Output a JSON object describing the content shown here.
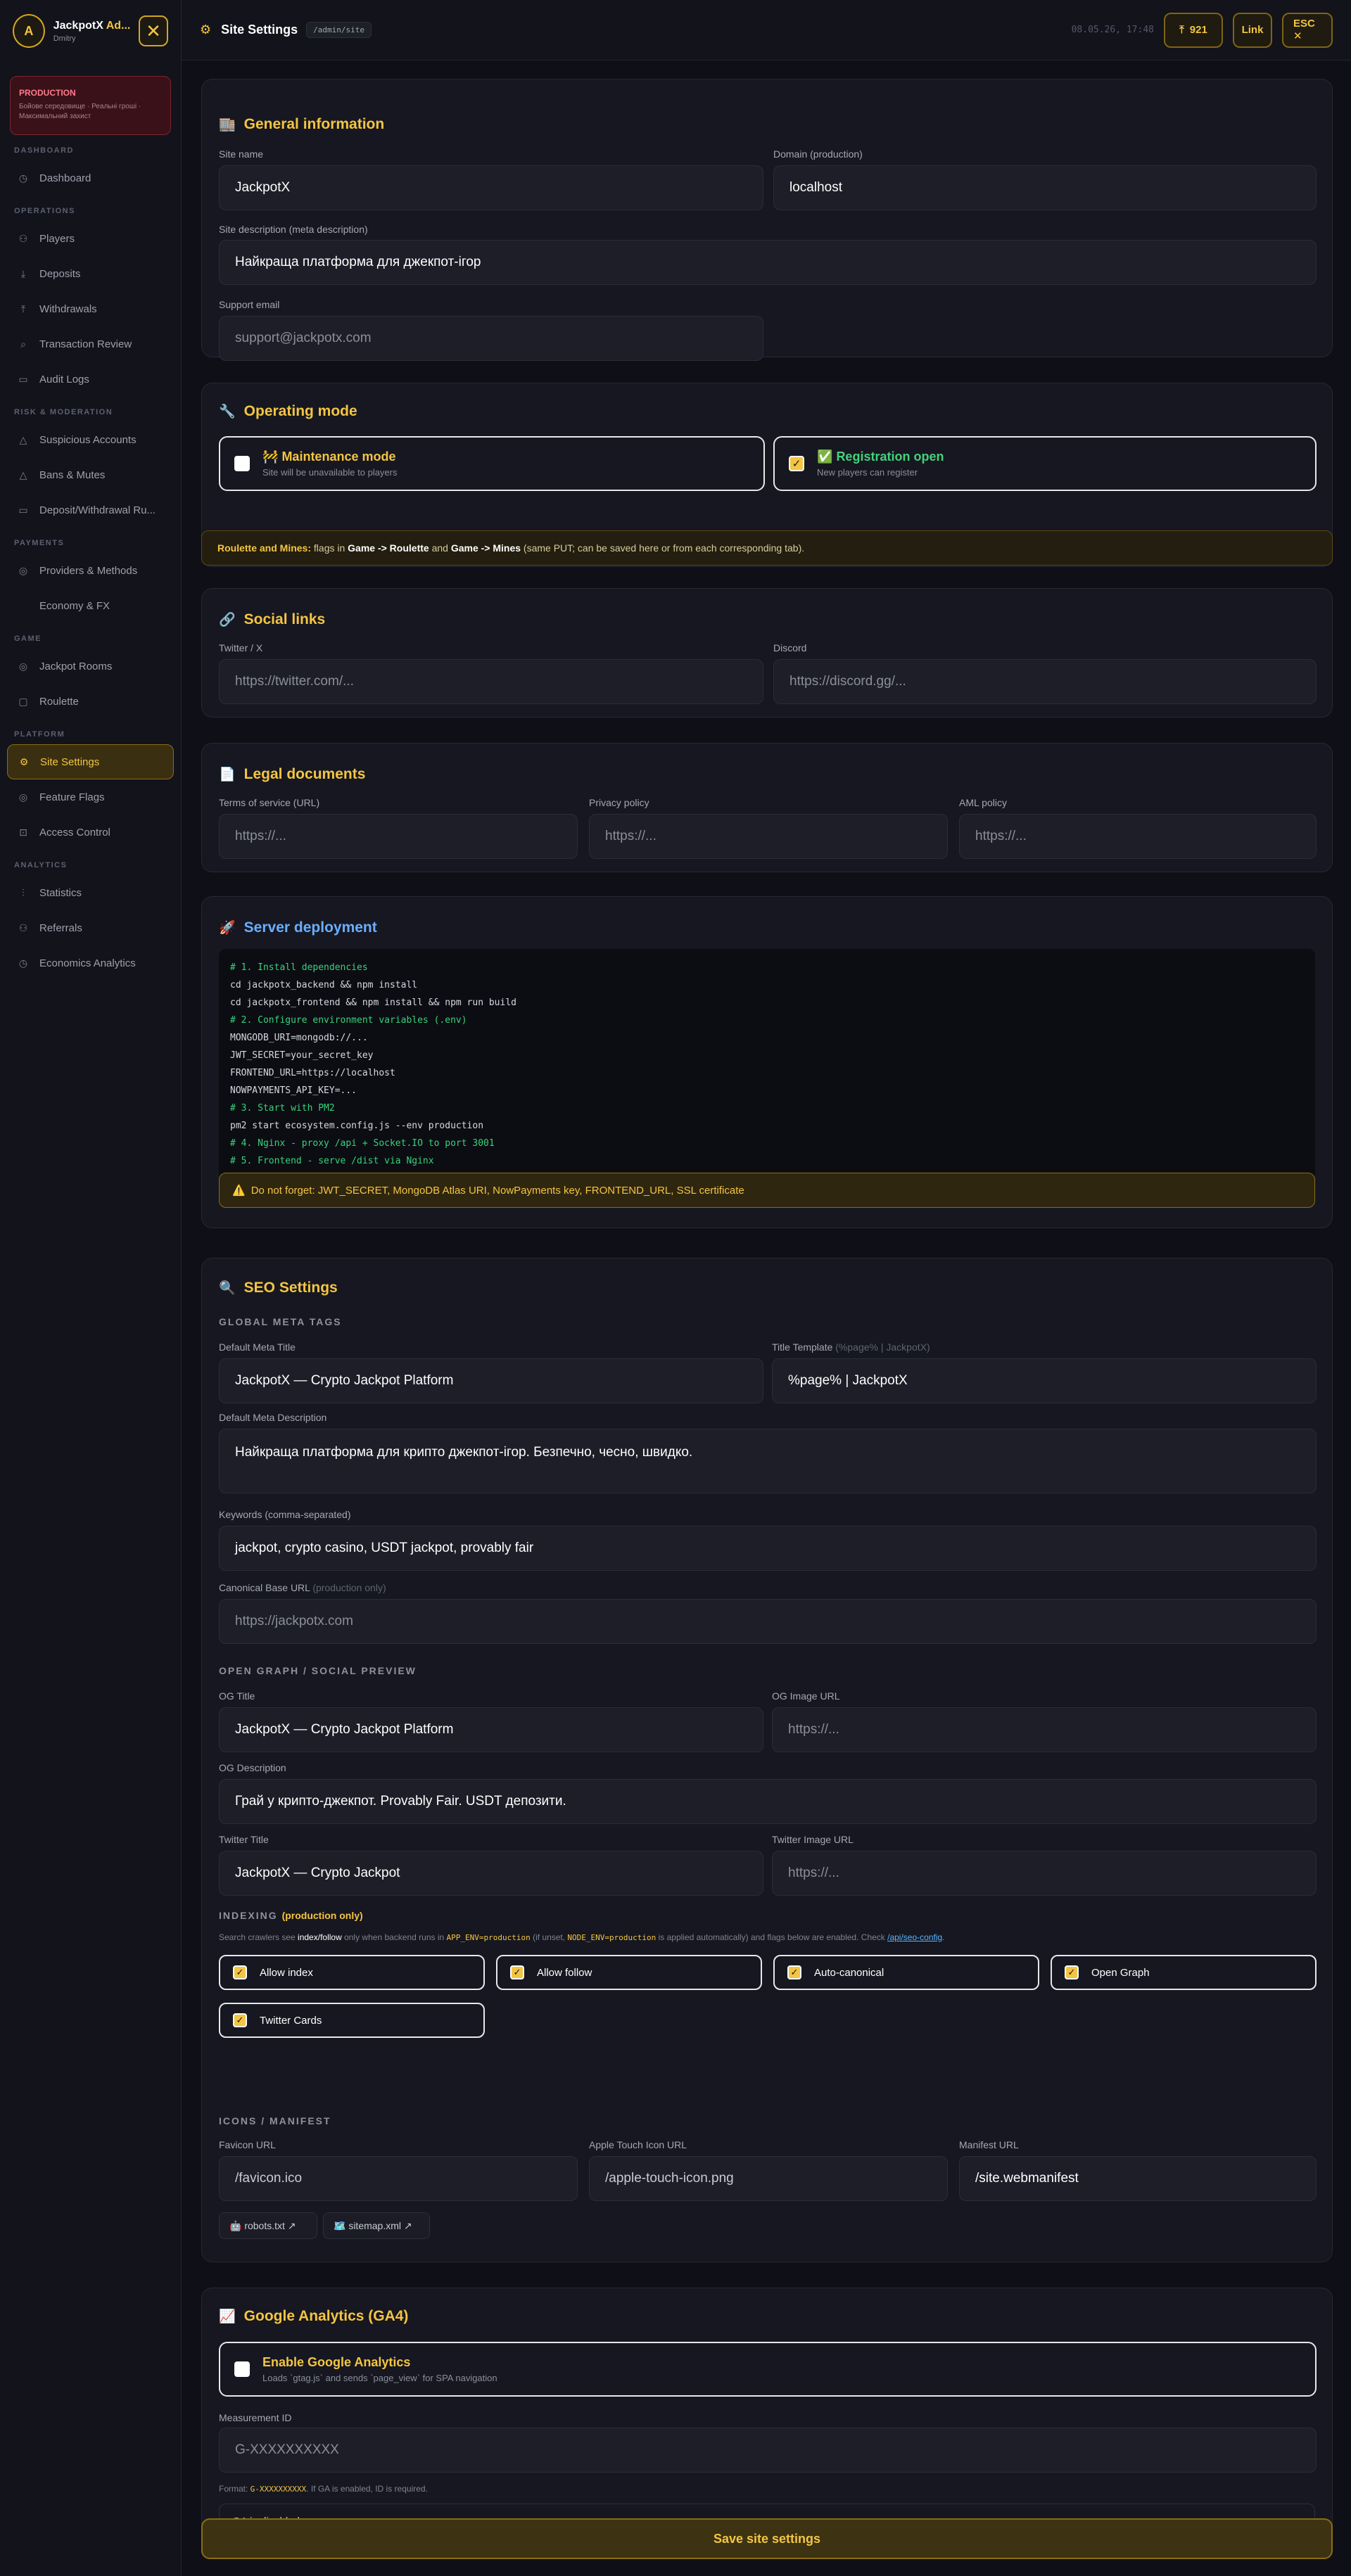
{
  "sidebar": {
    "avatar_letter": "A",
    "brand": "JackpotX",
    "brand_suffix": " Ad...",
    "user": "Dmitry",
    "close_glyph": "✕",
    "env": {
      "title": "PRODUCTION",
      "subtitle": "Бойове середовище · Реальні гроші · Максимальний захист"
    },
    "sections": [
      {
        "title": "DASHBOARD",
        "items": [
          {
            "label": "Dashboard",
            "icon": "◷"
          }
        ]
      },
      {
        "title": "OPERATIONS",
        "items": [
          {
            "label": "Players",
            "icon": "⚇"
          },
          {
            "label": "Deposits",
            "icon": "⤓"
          },
          {
            "label": "Withdrawals",
            "icon": "⤒"
          },
          {
            "label": "Transaction Review",
            "icon": "⌕"
          },
          {
            "label": "Audit Logs",
            "icon": "▭"
          }
        ]
      },
      {
        "title": "RISK & MODERATION",
        "items": [
          {
            "label": "Suspicious Accounts",
            "icon": "△"
          },
          {
            "label": "Bans & Mutes",
            "icon": "△"
          },
          {
            "label": "Deposit/Withdrawal Ru...",
            "icon": "▭"
          }
        ]
      },
      {
        "title": "PAYMENTS",
        "items": [
          {
            "label": "Providers & Methods",
            "icon": "◎"
          },
          {
            "label": "Economy & FX",
            "icon": ""
          }
        ]
      },
      {
        "title": "GAME",
        "items": [
          {
            "label": "Jackpot Rooms",
            "icon": "◎"
          },
          {
            "label": "Roulette",
            "icon": "▢"
          }
        ]
      },
      {
        "title": "PLATFORM",
        "items": [
          {
            "label": "Site Settings",
            "icon": "⚙",
            "active": true
          },
          {
            "label": "Feature Flags",
            "icon": "◎"
          },
          {
            "label": "Access Control",
            "icon": "⊡"
          }
        ]
      },
      {
        "title": "ANALYTICS",
        "items": [
          {
            "label": "Statistics",
            "icon": "⫶"
          },
          {
            "label": "Referrals",
            "icon": "⚇"
          },
          {
            "label": "Economics Analytics",
            "icon": "◷"
          }
        ]
      }
    ]
  },
  "topbar": {
    "icon": "⚙",
    "title": "Site Settings",
    "path": "/admin/site",
    "clock": "08.05.26, 17:48",
    "count_icon": "⤒",
    "count": "921",
    "link_label": "Link",
    "esc_label": "ESC ✕"
  },
  "general": {
    "icon": "🏬",
    "title": "General information",
    "site_name_label": "Site name",
    "site_name": "JackpotX",
    "domain_label": "Domain (production)",
    "domain": "localhost",
    "desc_label": "Site description (meta description)",
    "desc": "Найкраща платформа для джекпот-ігор",
    "email_label": "Support email",
    "email_placeholder": "support@jackpotx.com"
  },
  "mode": {
    "icon": "🔧",
    "title": "Operating mode",
    "maintenance_icon": "🚧",
    "maintenance_title": "Maintenance mode",
    "maintenance_sub": "Site will be unavailable to players",
    "registration_icon": "✅",
    "registration_title": "Registration open",
    "registration_sub": "New players can register",
    "checkmark": "✓"
  },
  "notice": {
    "lead": "Roulette and Mines:",
    "p1": " flags in ",
    "g1": "Game -> Roulette",
    "p2": " and ",
    "g2": "Game -> Mines",
    "p3": " (same PUT; can be saved here or from each corresponding tab)."
  },
  "social": {
    "icon": "🔗",
    "title": "Social links",
    "twitter_label": "Twitter / X",
    "twitter_ph": "https://twitter.com/...",
    "discord_label": "Discord",
    "discord_ph": "https://discord.gg/..."
  },
  "legal": {
    "icon": "📄",
    "title": "Legal documents",
    "tos_label": "Terms of service (URL)",
    "privacy_label": "Privacy policy",
    "aml_label": "AML policy",
    "ph": "https://..."
  },
  "deploy": {
    "icon": "🚀",
    "title": "Server deployment",
    "lines": [
      {
        "t": "# 1. Install dependencies",
        "c": true
      },
      {
        "t": "cd jackpotx_backend && npm install",
        "c": false
      },
      {
        "t": "cd jackpotx_frontend && npm install && npm run build",
        "c": false
      },
      {
        "t": "# 2. Configure environment variables (.env)",
        "c": true
      },
      {
        "t": "MONGODB_URI=mongodb://...",
        "c": false
      },
      {
        "t": "JWT_SECRET=your_secret_key",
        "c": false
      },
      {
        "t": "FRONTEND_URL=https://localhost",
        "c": false
      },
      {
        "t": "NOWPAYMENTS_API_KEY=...",
        "c": false
      },
      {
        "t": "# 3. Start with PM2",
        "c": true
      },
      {
        "t": "pm2 start ecosystem.config.js --env production",
        "c": false
      },
      {
        "t": "# 4. Nginx - proxy /api + Socket.IO to port 3001",
        "c": true
      },
      {
        "t": "# 5. Frontend - serve /dist via Nginx",
        "c": true
      }
    ],
    "warning_icon": "⚠️",
    "warning": "Do not forget: JWT_SECRET, MongoDB Atlas URI, NowPayments key, FRONTEND_URL, SSL certificate"
  },
  "seo": {
    "icon": "🔍",
    "title": "SEO Settings",
    "global_title": "GLOBAL META TAGS",
    "meta_title_label": "Default Meta Title",
    "meta_title": "JackpotX — Crypto Jackpot Platform",
    "template_label": "Title Template",
    "template_hint": " (%page% | JackpotX)",
    "template": "%page% | JackpotX",
    "meta_desc_label": "Default Meta Description",
    "meta_desc": "Найкраща платформа для крипто джекпот-ігор. Безпечно, чесно, швидко.",
    "keywords_label": "Keywords (comma-separated)",
    "keywords": "jackpot, crypto casino, USDT jackpot, provably fair",
    "canonical_label": "Canonical Base URL",
    "canonical_hint": " (production only)",
    "canonical": "https://jackpotx.com",
    "og_section": "OPEN GRAPH / SOCIAL PREVIEW",
    "og_title_label": "OG Title",
    "og_title": "JackpotX — Crypto Jackpot Platform",
    "og_image_label": "OG Image URL",
    "og_image_ph": "https://...",
    "og_desc_label": "OG Description",
    "og_desc": "Грай у крипто-джекпот. Provably Fair. USDT депозити.",
    "tw_title_label": "Twitter Title",
    "tw_title": "JackpotX — Crypto Jackpot",
    "tw_image_label": "Twitter Image URL",
    "tw_image_ph": "https://...",
    "indexing_title": "INDEXING",
    "indexing_hint": "(production only)",
    "indexing_note": {
      "a": "Search crawlers see ",
      "b": "index/follow",
      "c": " only when backend runs in ",
      "d": "APP_ENV=production",
      "e": " (if unset, ",
      "f": "NODE_ENV=production",
      "g": " is applied automatically) and flags below are enabled. Check ",
      "h": "/api/seo-config",
      "i": "."
    },
    "flags": [
      "Allow index",
      "Allow follow",
      "Auto-canonical",
      "Open Graph",
      "Twitter Cards"
    ],
    "icons_title": "ICONS / MANIFEST",
    "favicon_label": "Favicon URL",
    "favicon": "/favicon.ico",
    "apple_label": "Apple Touch Icon URL",
    "apple": "/apple-touch-icon.png",
    "manifest_label": "Manifest URL",
    "manifest": "/site.webmanifest",
    "robots_link": "🤖 robots.txt ↗",
    "sitemap_link": "🗺️ sitemap.xml ↗"
  },
  "ga": {
    "icon": "📈",
    "title": "Google Analytics (GA4)",
    "enable_title": "Enable Google Analytics",
    "enable_sub": "Loads `gtag.js` and sends `page_view` for SPA navigation",
    "id_label": "Measurement ID",
    "id_ph": "G-XXXXXXXXXX",
    "format_a": "Format: ",
    "format_code": "G-XXXXXXXXXX",
    "format_b": ". If GA is enabled, ID is required.",
    "status": "GA is disabled"
  },
  "save_label": "Save site settings"
}
